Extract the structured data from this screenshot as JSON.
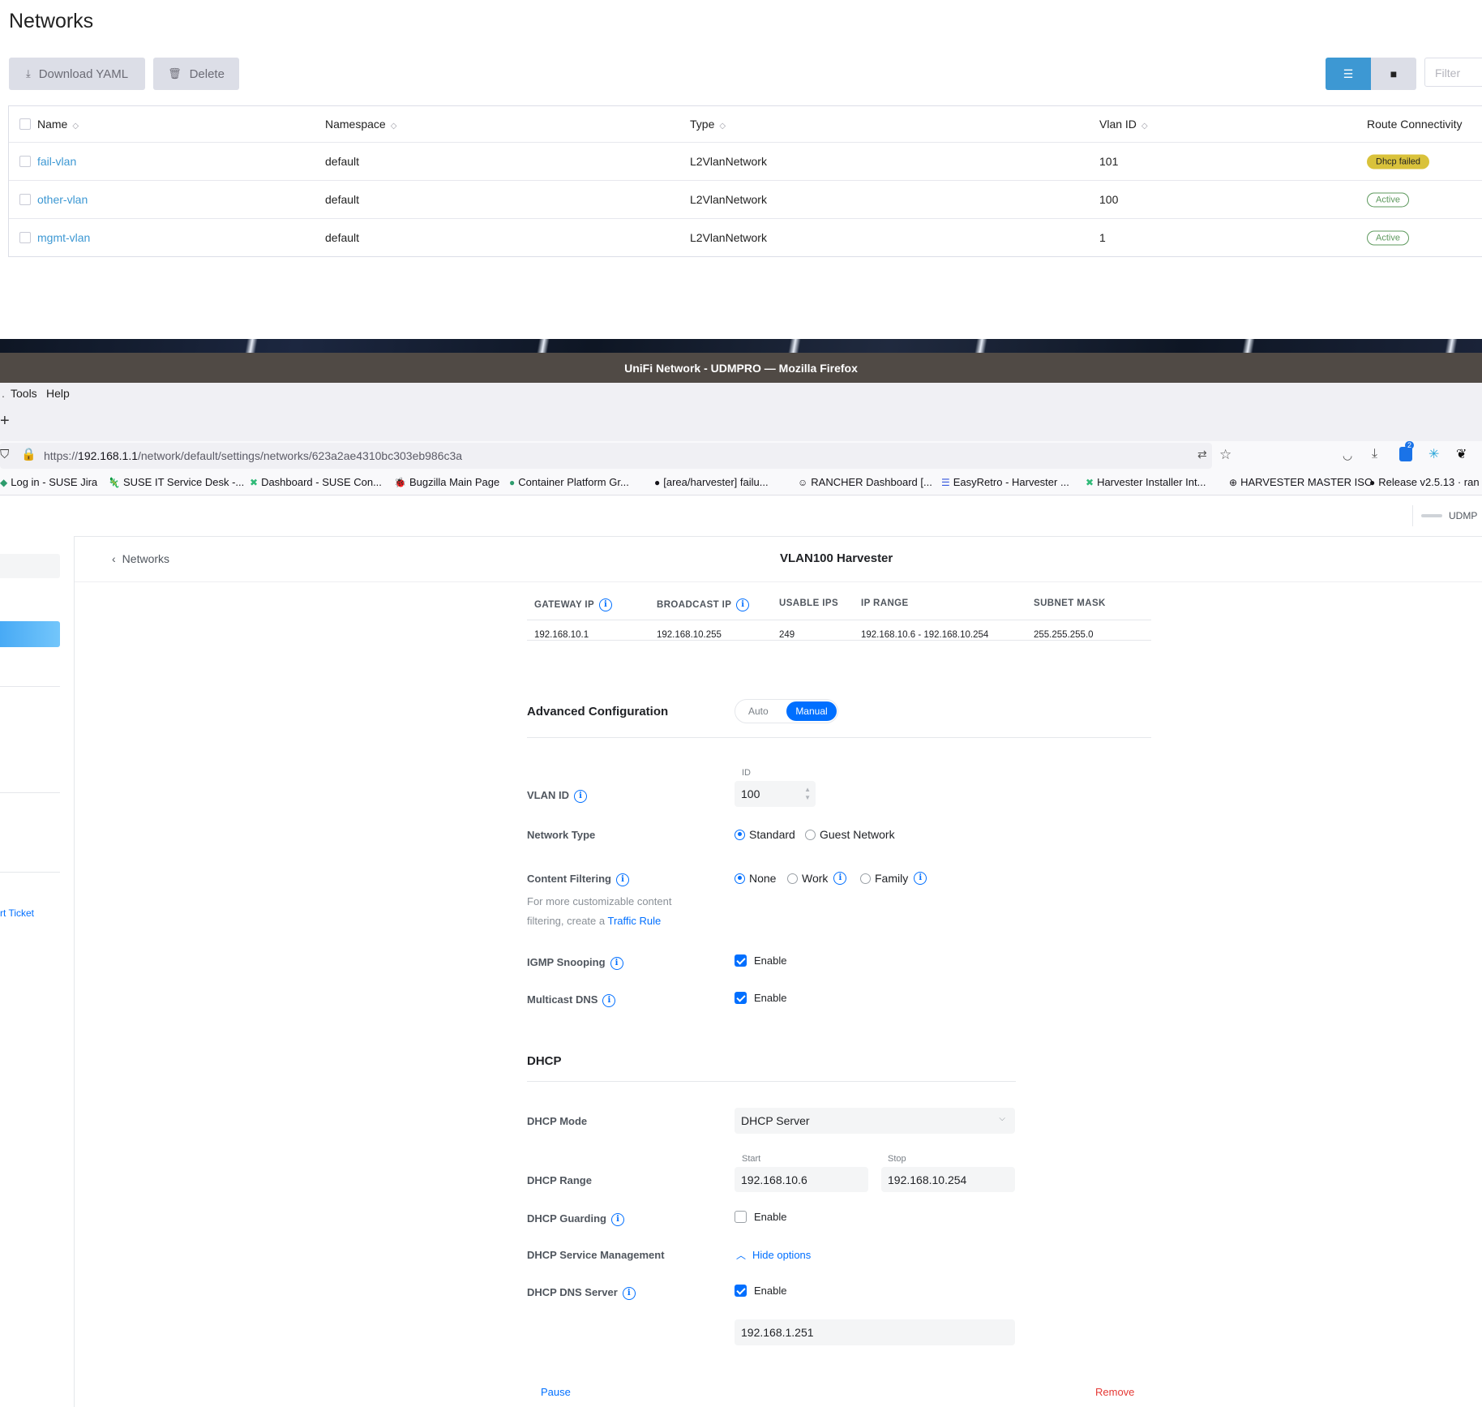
{
  "rancher": {
    "title": "Networks",
    "download_label": "Download YAML",
    "delete_label": "Delete",
    "filter_placeholder": "Filter",
    "columns": [
      "Name",
      "Namespace",
      "Type",
      "Vlan ID",
      "Route Connectivity"
    ],
    "rows": [
      {
        "name": "fail-vlan",
        "namespace": "default",
        "type": "L2VlanNetwork",
        "vlan": "101",
        "status": "Dhcp failed"
      },
      {
        "name": "other-vlan",
        "namespace": "default",
        "type": "L2VlanNetwork",
        "vlan": "100",
        "status": "Active"
      },
      {
        "name": "mgmt-vlan",
        "namespace": "default",
        "type": "L2VlanNetwork",
        "vlan": "1",
        "status": "Active"
      }
    ]
  },
  "firefox": {
    "window_title": "UniFi Network - UDMPRO — Mozilla Firefox",
    "menu": [
      "Tools",
      "Help"
    ],
    "url_prefix": "https://",
    "url_host": "192.168.1.1",
    "url_path": "/network/default/settings/networks/623a2ae4310bc303eb986c3a",
    "badge_count": "2",
    "bookmarks": [
      "Log in - SUSE Jira",
      "SUSE IT Service Desk -...",
      "Dashboard - SUSE Con...",
      "Bugzilla Main Page",
      "Container Platform Gr...",
      "[area/harvester] failu...",
      "RANCHER Dashboard [...",
      "EasyRetro - Harvester ...",
      "Harvester Installer Int...",
      "HARVESTER MASTER ISO",
      "Release v2.5.13 · ran"
    ]
  },
  "unifi": {
    "console_label": "UDMP",
    "breadcrumb": "Networks",
    "page_title": "VLAN100 Harvester",
    "sidebar_link": "rt Ticket",
    "summary": {
      "headers": [
        "GATEWAY IP",
        "BROADCAST IP",
        "USABLE IPS",
        "IP RANGE",
        "SUBNET MASK"
      ],
      "values": [
        "192.168.10.1",
        "192.168.10.255",
        "249",
        "192.168.10.6 - 192.168.10.254",
        "255.255.255.0"
      ]
    },
    "advanced": {
      "title": "Advanced Configuration",
      "auto": "Auto",
      "manual": "Manual"
    },
    "vlan": {
      "label": "VLAN ID",
      "id_caption": "ID",
      "value": "100"
    },
    "network_type": {
      "label": "Network Type",
      "standard": "Standard",
      "guest": "Guest Network"
    },
    "content_filtering": {
      "label": "Content Filtering",
      "help_line1": "For more customizable content",
      "help_line2": "filtering, create a ",
      "help_link": "Traffic Rule",
      "none": "None",
      "work": "Work",
      "family": "Family"
    },
    "igmp": {
      "label": "IGMP Snooping",
      "enable": "Enable"
    },
    "mdns": {
      "label": "Multicast DNS",
      "enable": "Enable"
    },
    "dhcp": {
      "title": "DHCP",
      "mode_label": "DHCP Mode",
      "mode_value": "DHCP Server",
      "range_label": "DHCP Range",
      "start_caption": "Start",
      "stop_caption": "Stop",
      "start": "192.168.10.6",
      "stop": "192.168.10.254",
      "guarding_label": "DHCP Guarding",
      "guarding_enable": "Enable",
      "service_label": "DHCP Service Management",
      "hide_options": "Hide options",
      "dns_label": "DHCP DNS Server",
      "dns_enable": "Enable",
      "dns_value": "192.168.1.251"
    },
    "pause": "Pause",
    "remove": "Remove",
    "colors": {
      "accent": "#006fff",
      "remove": "#e53935"
    }
  }
}
